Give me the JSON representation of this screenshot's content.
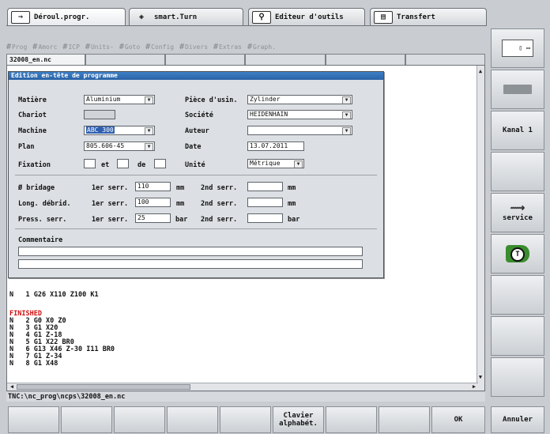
{
  "mode_tabs": [
    {
      "label": "Déroul.progr.",
      "icon": "run-program-arrow-icon",
      "glyph": "⇒"
    },
    {
      "label": "smart.Turn",
      "icon": "smart-turn-diamond-icon",
      "glyph": "◈"
    },
    {
      "label": "Editeur d'outils",
      "icon": "tool-editor-icon",
      "glyph": "⚲"
    },
    {
      "label": "Transfert",
      "icon": "transfer-icon",
      "glyph": "▤"
    }
  ],
  "menu": [
    "Prog",
    "Amorc",
    "ICP",
    "Units-",
    "Goto",
    "Config",
    "Divers",
    "Extras",
    "Graph."
  ],
  "file_tab": "32008_en.nc",
  "dialog": {
    "title": "Edition en-tête de programme",
    "labels": {
      "matiere": "Matière",
      "chariot": "Chariot",
      "machine": "Machine",
      "plan": "Plan",
      "fixation": "Fixation",
      "et": "et",
      "de": "de",
      "piece": "Pièce d'usin.",
      "societe": "Société",
      "auteur": "Auteur",
      "date": "Date",
      "unite": "Unité",
      "bridage": "Ø bridage",
      "long": "Long. débrid.",
      "press": "Press. serr.",
      "ser1": "1er serr.",
      "ser2": "2nd serr.",
      "commentaire": "Commentaire"
    },
    "values": {
      "matiere": "Aluminium",
      "chariot": "",
      "machine": "ABC 300",
      "plan": "805.606-45",
      "fixation_1": "",
      "fixation_2": "",
      "fixation_3": "",
      "piece": "Zylinder",
      "societe": "HEIDENHAIN",
      "auteur": "",
      "date": "13.07.2011",
      "unite": "Métrique",
      "bridage_1": "110",
      "bridage_2": "",
      "long_1": "100",
      "long_2": "",
      "press_1": "25",
      "press_2": "",
      "comment_1": "",
      "comment_2": ""
    },
    "units": {
      "mm": "mm",
      "bar": "bar"
    }
  },
  "code_lines": [
    {
      "text": "N   1 G26 X110 Z100 K1",
      "color": "#111111"
    },
    {
      "text": "FINISHED",
      "color": "#d01010"
    },
    {
      "text": "N   2 G0 X0 Z0",
      "color": "#111111"
    },
    {
      "text": "N   3 G1 X20",
      "color": "#111111"
    },
    {
      "text": "N   4 G1 Z-18",
      "color": "#111111"
    },
    {
      "text": "N   5 G1 X22 BR0",
      "color": "#111111"
    },
    {
      "text": "N   6 G13 X46 Z-30 I11 BR0",
      "color": "#111111"
    },
    {
      "text": "N   7 G1 Z-34",
      "color": "#111111"
    },
    {
      "text": "N   8 G1 X48",
      "color": "#111111"
    }
  ],
  "path": "TNC:\\nc_prog\\ncps\\32008_en.nc",
  "right_softkeys": [
    {
      "label": "",
      "icon": "program-view-icon"
    },
    {
      "label": "",
      "icon": "machine-part-icon"
    },
    {
      "label": "Kanal 1",
      "icon": ""
    },
    {
      "label": "",
      "icon": ""
    },
    {
      "label": "service",
      "icon": "wrench-icon"
    },
    {
      "label": "",
      "icon": "tool-t-icon"
    },
    {
      "label": "",
      "icon": ""
    },
    {
      "label": "",
      "icon": ""
    },
    {
      "label": "",
      "icon": ""
    }
  ],
  "bottom_softkeys": [
    "",
    "",
    "",
    "",
    "",
    "Clavier\nalphabét.",
    "",
    "",
    "OK",
    "Annuler"
  ],
  "colors": {
    "accent": "#2f60b0",
    "title_bar": "#3d7fc6",
    "finished": "#d01010"
  }
}
